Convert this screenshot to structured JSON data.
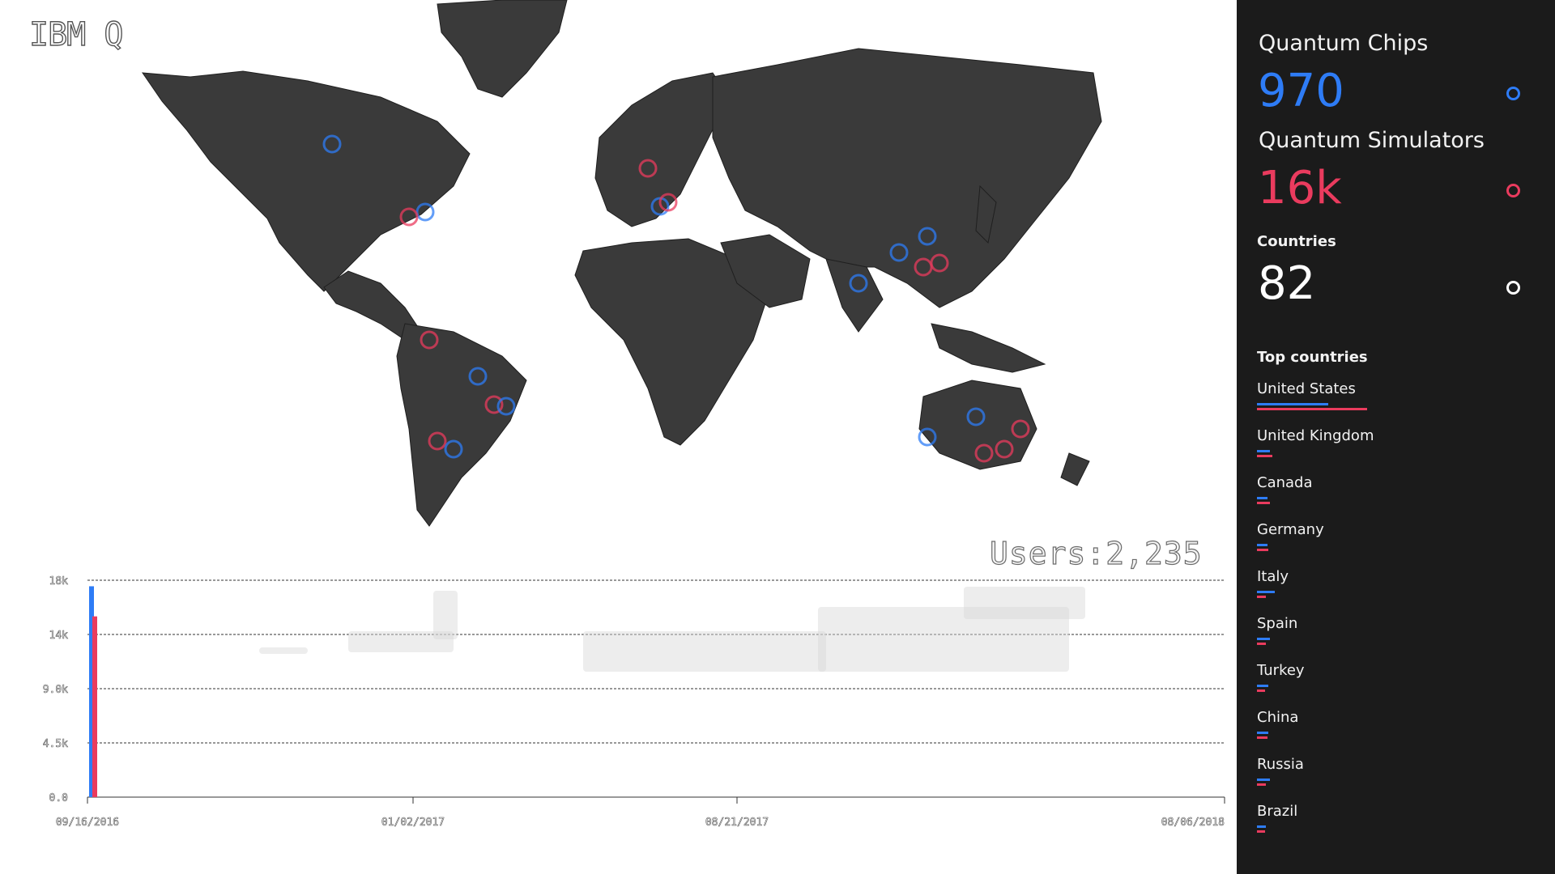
{
  "logo": "IBM Q",
  "users_label": "Users:2,235",
  "sidebar": {
    "chips": {
      "label": "Quantum Chips",
      "value": "970",
      "color": "#2e7cf6"
    },
    "simulators": {
      "label": "Quantum Simulators",
      "value": "16k",
      "color": "#ea3b5e"
    },
    "countries": {
      "label": "Countries",
      "value": "82",
      "color": "#ffffff"
    },
    "top_label": "Top countries",
    "top_countries": [
      {
        "name": "United States",
        "chips": 0.55,
        "sims": 0.85
      },
      {
        "name": "United Kingdom",
        "chips": 0.1,
        "sims": 0.12
      },
      {
        "name": "Canada",
        "chips": 0.08,
        "sims": 0.1
      },
      {
        "name": "Germany",
        "chips": 0.08,
        "sims": 0.09
      },
      {
        "name": "Italy",
        "chips": 0.14,
        "sims": 0.07
      },
      {
        "name": "Spain",
        "chips": 0.1,
        "sims": 0.07
      },
      {
        "name": "Turkey",
        "chips": 0.09,
        "sims": 0.06
      },
      {
        "name": "China",
        "chips": 0.09,
        "sims": 0.08
      },
      {
        "name": "Russia",
        "chips": 0.1,
        "sims": 0.07
      },
      {
        "name": "Brazil",
        "chips": 0.07,
        "sims": 0.06
      }
    ]
  },
  "map": {
    "land_color": "#3a3a3a",
    "chip_color": "#2e7cf6",
    "sim_color": "#ea3b5e"
  },
  "chart_data": {
    "type": "bar",
    "y_ticks": [
      "0.0",
      "4.5k",
      "9.0k",
      "14k",
      "18k"
    ],
    "x_ticks": [
      "09/16/2016",
      "01/02/2017",
      "08/21/2017",
      "08/06/2018"
    ],
    "ylim": [
      0,
      18000
    ],
    "grid": true,
    "series": [
      {
        "values": [
          17500
        ],
        "color": "#2e7cf6"
      },
      {
        "values": [
          15000
        ],
        "color": "#ea3b5e"
      }
    ]
  }
}
